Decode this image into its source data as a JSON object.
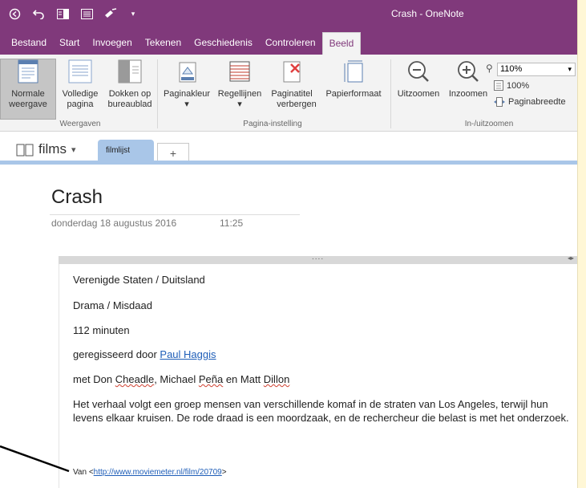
{
  "window": {
    "title": "Crash - OneNote"
  },
  "qat": {
    "icons": [
      "back-circle-icon",
      "undo-icon",
      "dock-icon",
      "page-view-icon",
      "format-painter-icon",
      "customize-dropdown-icon"
    ]
  },
  "tabs": [
    "Bestand",
    "Start",
    "Invoegen",
    "Tekenen",
    "Geschiedenis",
    "Controleren",
    "Beeld"
  ],
  "active_tab": "Beeld",
  "ribbon": {
    "views": {
      "normal_l1": "Normale",
      "normal_l2": "weergave",
      "full_l1": "Volledige",
      "full_l2": "pagina",
      "dock_l1": "Dokken op",
      "dock_l2": "bureaublad",
      "group": "Weergaven"
    },
    "page_setup": {
      "color": "Paginakleur",
      "lines": "Regellijnen",
      "hide_l1": "Paginatitel",
      "hide_l2": "verbergen",
      "paper": "Papierformaat",
      "group": "Pagina-instelling"
    },
    "zoom": {
      "out": "Uitzoomen",
      "in": "Inzoomen",
      "value": "110%",
      "hundred": "100%",
      "width": "Paginabreedte",
      "group": "In-/uitzoomen"
    }
  },
  "notebook": {
    "name": "films",
    "section": "filmlijst",
    "add": "+"
  },
  "page": {
    "title": "Crash",
    "date": "donderdag 18 augustus 2016",
    "time": "11:25",
    "dots": "....",
    "lines": {
      "l1": "Verenigde Staten / Duitsland",
      "l2": "Drama / Misdaad",
      "l3": "112 minuten",
      "l4_prefix": "geregisseerd door ",
      "l4_link": "Paul Haggis",
      "l5_a": "met Don ",
      "l5_b": "Cheadle",
      "l5_c": ", Michael ",
      "l5_d": "Peña",
      "l5_e": " en Matt ",
      "l5_f": "Dillon"
    },
    "paragraph": "Het verhaal volgt een groep mensen van verschillende komaf in de straten van Los Angeles, terwijl hun levens elkaar kruisen. De rode draad is een moordzaak, en de rechercheur die belast is met het onderzoek.",
    "source_prefix": "Van <",
    "source_url": "http://www.moviemeter.nl/film/20709",
    "source_suffix": ">"
  },
  "colors": {
    "accent": "#80397b",
    "section": "#a9c6e8",
    "link": "#1f5eb8"
  }
}
